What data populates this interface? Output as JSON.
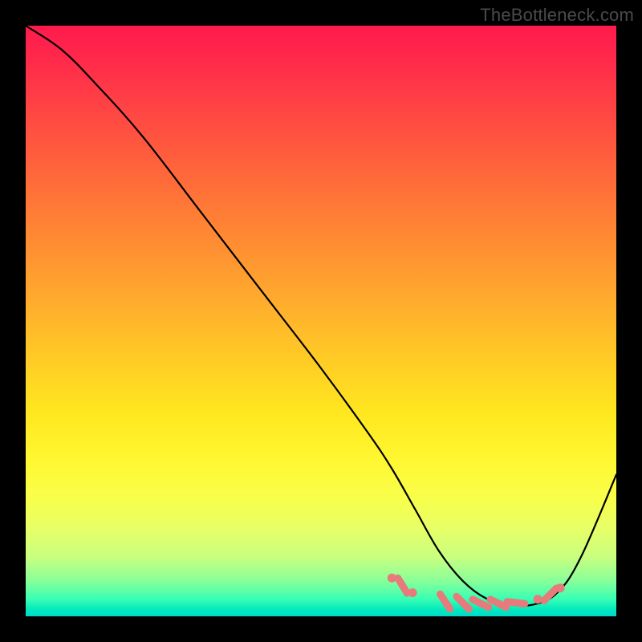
{
  "watermark": "TheBottleneck.com",
  "chart_data": {
    "type": "line",
    "title": "",
    "xlabel": "",
    "ylabel": "",
    "xlim": [
      0,
      100
    ],
    "ylim": [
      0,
      100
    ],
    "grid": false,
    "legend": false,
    "background_gradient": {
      "top": "#ff1a4d",
      "mid": "#ffe81f",
      "bottom": "#00d8c8"
    },
    "series": [
      {
        "name": "curve",
        "x": [
          0,
          6,
          12,
          20,
          30,
          40,
          50,
          58,
          62,
          66,
          70,
          74,
          78,
          82,
          86,
          90,
          94,
          100
        ],
        "y": [
          100,
          96,
          90,
          81,
          68,
          55,
          42,
          31,
          25,
          18,
          11,
          6,
          3,
          2,
          2,
          4,
          10,
          24
        ]
      }
    ],
    "markers": [
      {
        "shape": "dot",
        "x": 62.0,
        "y": 6.5
      },
      {
        "shape": "dash",
        "x": 63.8,
        "y": 5.2
      },
      {
        "shape": "dot",
        "x": 65.5,
        "y": 4.0
      },
      {
        "shape": "dash",
        "x": 71.0,
        "y": 2.5
      },
      {
        "shape": "dash",
        "x": 74.0,
        "y": 2.3
      },
      {
        "shape": "dash",
        "x": 77.0,
        "y": 2.2
      },
      {
        "shape": "dash",
        "x": 80.0,
        "y": 2.2
      },
      {
        "shape": "dash",
        "x": 83.0,
        "y": 2.3
      },
      {
        "shape": "dot",
        "x": 86.7,
        "y": 2.9
      },
      {
        "shape": "dash",
        "x": 88.8,
        "y": 3.7
      },
      {
        "shape": "dot",
        "x": 90.5,
        "y": 4.8
      }
    ]
  }
}
